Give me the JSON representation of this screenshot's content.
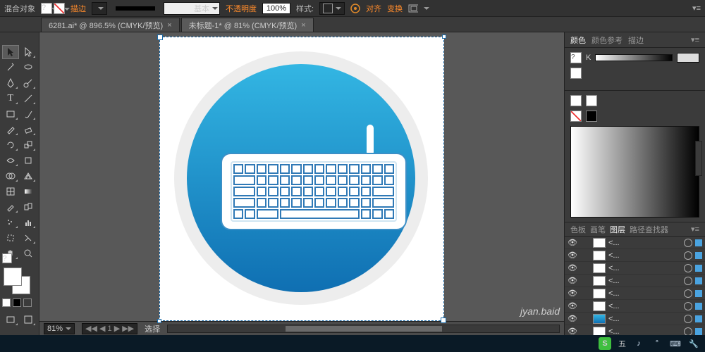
{
  "menubar": {
    "title": "混合对象",
    "qmark": "?",
    "stroke_label": "描边",
    "stroke_dd": "",
    "basic_label": "基本",
    "opacity_label": "不透明度",
    "opacity_value": "100%",
    "style_label": "样式:",
    "align_label": "对齐",
    "transform_label": "变换"
  },
  "tabs": {
    "items": [
      {
        "label": "6281.ai* @ 896.5% (CMYK/预览)",
        "active": false
      },
      {
        "label": "未标题-1* @ 81% (CMYK/预览)",
        "active": true
      }
    ]
  },
  "canvas": {
    "zoom": "81%",
    "status_tool": "选择"
  },
  "panels": {
    "color": {
      "tabs": [
        "颜色",
        "颜色参考",
        "描边"
      ],
      "active": 0,
      "channel": "K"
    },
    "layers": {
      "tabs": [
        "色板",
        "画笔",
        "图层",
        "路径查找器"
      ],
      "active": 2,
      "items": [
        {
          "name": "<..."
        },
        {
          "name": "<..."
        },
        {
          "name": "<..."
        },
        {
          "name": "<..."
        },
        {
          "name": "<..."
        },
        {
          "name": "<..."
        },
        {
          "name": "<..."
        },
        {
          "name": "<..."
        }
      ]
    }
  },
  "taskbar": {
    "ime": "S",
    "ime_label": "五"
  },
  "watermark": "jyan.baid"
}
